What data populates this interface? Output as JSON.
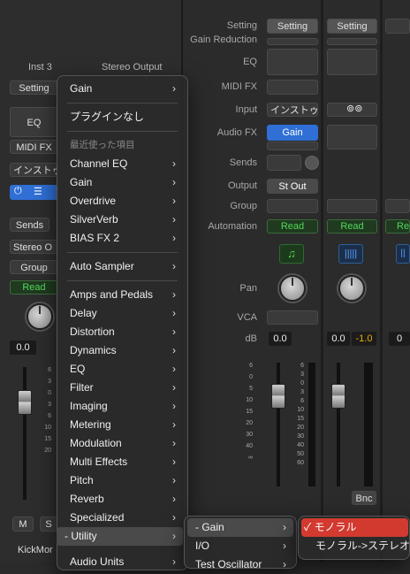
{
  "left_strip": {
    "name": "Inst 3",
    "setting": "Setting",
    "eq": "EQ",
    "midi_fx": "MIDI FX",
    "input": "インストゥ",
    "sends": "Sends",
    "output": "Stereo O",
    "group": "Group",
    "automation": "Read",
    "pan_value": "0.0",
    "track_name": "KickMor",
    "mute": "M",
    "solo": "S"
  },
  "stereo_output": {
    "name": "Stereo Output"
  },
  "row_labels": {
    "setting": "Setting",
    "gain_reduction": "Gain Reduction",
    "eq": "EQ",
    "midi_fx": "MIDI FX",
    "input": "Input",
    "audio_fx": "Audio FX",
    "sends": "Sends",
    "output": "Output",
    "group": "Group",
    "automation": "Automation",
    "pan": "Pan",
    "vca": "VCA",
    "db": "dB"
  },
  "strip_a": {
    "setting": "Setting",
    "input": "インストゥ",
    "audio_fx": "Gain",
    "output": "St Out",
    "automation": "Read",
    "db_value": "0.0"
  },
  "strip_b": {
    "setting": "Setting",
    "automation": "Read",
    "db_value": "0.0",
    "peak_value": "-1.0",
    "bounce": "Bnc"
  },
  "strip_c": {
    "automation": "Re",
    "db_value": "0"
  },
  "fader_scale": [
    "6",
    "3",
    "0",
    "3",
    "6",
    "10",
    "15",
    "20",
    "30",
    "40",
    "50",
    "60"
  ],
  "fader_scale_b": [
    "6",
    "0",
    "5",
    "10",
    "15",
    "20",
    "30",
    "40",
    "∞"
  ],
  "plugin_menu": {
    "top_item": "Gain",
    "no_plugin": "プラグインなし",
    "recent_header": "最近使った項目",
    "recent": [
      "Channel EQ",
      "Gain",
      "Overdrive",
      "SilverVerb",
      "BIAS FX 2"
    ],
    "auto_sampler": "Auto Sampler",
    "categories": [
      "Amps and Pedals",
      "Delay",
      "Distortion",
      "Dynamics",
      "EQ",
      "Filter",
      "Imaging",
      "Metering",
      "Modulation",
      "Multi Effects",
      "Pitch",
      "Reverb",
      "Specialized",
      "- Utility",
      "Audio Units"
    ]
  },
  "utility_submenu": {
    "items": [
      "- Gain",
      "I/O",
      "Test Oscillator"
    ]
  },
  "gain_submenu": {
    "items": [
      "モノラル",
      "モノラル->ステレオ"
    ],
    "check": "✓"
  },
  "colors": {
    "accent_blue": "#2f6fd6",
    "read_green": "#53d85a",
    "menu_red": "#d23a30",
    "peak_yellow": "#e6b000"
  }
}
